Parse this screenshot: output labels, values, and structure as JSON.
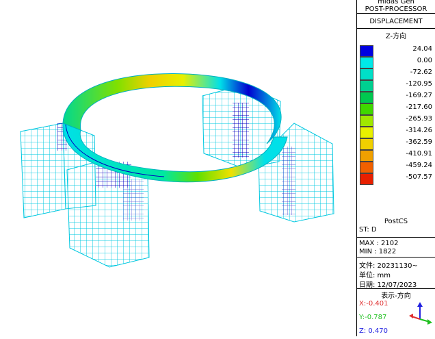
{
  "panel": {
    "app": "midas Gen",
    "module": "POST-PROCESSOR",
    "result": "DISPLACEMENT",
    "component": "Z-方向",
    "stage_name": "PostCS",
    "stage": "ST: D",
    "max": "MAX : 2102",
    "min": "MIN : 1822",
    "file": "文件: 20231130~",
    "unit": "单位: mm",
    "date": "日期: 12/07/2023",
    "view_dir": "表示-方向",
    "axis_x": "X:-0.401",
    "axis_y": "Y:-0.787",
    "axis_z": "Z: 0.470"
  },
  "legend": {
    "values": [
      "24.04",
      "0.00",
      "-72.62",
      "-120.95",
      "-169.27",
      "-217.60",
      "-265.93",
      "-314.26",
      "-362.59",
      "-410.91",
      "-459.24",
      "-507.57"
    ],
    "colors": [
      "#0000e0",
      "#00e8e8",
      "#00e0c8",
      "#00d090",
      "#00c850",
      "#40d800",
      "#a0e800",
      "#e8f000",
      "#f0d000",
      "#f0a000",
      "#f06000",
      "#e82000"
    ]
  },
  "colors": {
    "ring": "#00e0e8",
    "frame": "#00d8e8",
    "dense": "#0000d0"
  }
}
